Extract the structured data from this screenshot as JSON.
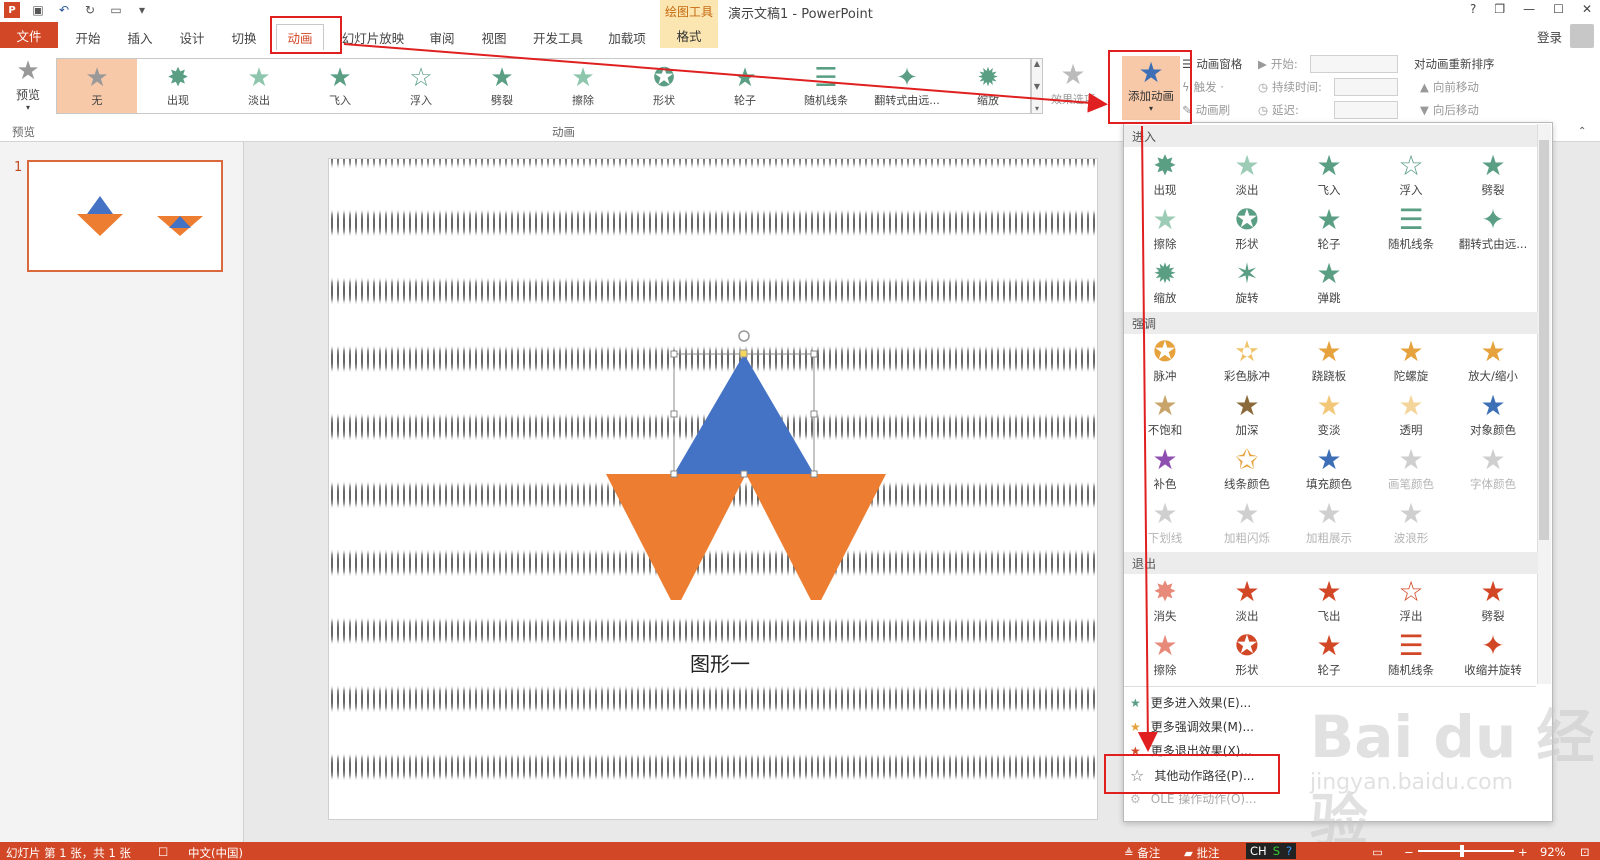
{
  "app": {
    "title": "演示文稿1 - PowerPoint",
    "context_tool": "绘图工具",
    "login": "登录"
  },
  "qat": {
    "icons": [
      "powerpoint-logo",
      "save-icon",
      "undo-icon",
      "redo-icon",
      "present-icon",
      "customize-icon"
    ]
  },
  "window": {
    "help": "?",
    "restore": "❐",
    "minimize": "—",
    "maximize": "☐",
    "close": "✕"
  },
  "tabs": [
    {
      "id": "home",
      "label": "开始"
    },
    {
      "id": "insert",
      "label": "插入"
    },
    {
      "id": "design",
      "label": "设计"
    },
    {
      "id": "transitions",
      "label": "切换"
    },
    {
      "id": "animations",
      "label": "动画"
    },
    {
      "id": "slideshow",
      "label": "幻灯片放映"
    },
    {
      "id": "review",
      "label": "审阅"
    },
    {
      "id": "view",
      "label": "视图"
    },
    {
      "id": "developer",
      "label": "开发工具"
    },
    {
      "id": "addins",
      "label": "加载项"
    }
  ],
  "tab_file": "文件",
  "tab_format": "格式",
  "ribbon": {
    "preview": {
      "label": "预览",
      "group": "预览"
    },
    "gallery_items": [
      "无",
      "出现",
      "淡出",
      "飞入",
      "浮入",
      "劈裂",
      "擦除",
      "形状",
      "轮子",
      "随机线条",
      "翻转式由远...",
      "缩放"
    ],
    "group_animation": "动画",
    "effect_options": "效果选项",
    "add_animation": "添加动画",
    "animation_pane": "动画窗格",
    "trigger": "触发 ·",
    "animation_painter": "动画刷",
    "start": "开始:",
    "duration": "持续时间:",
    "delay": "延迟:",
    "reorder": "对动画重新排序",
    "move_earlier": "向前移动",
    "move_later": "向后移动"
  },
  "slides": {
    "number": "1"
  },
  "slide": {
    "label": "图形一"
  },
  "dropdown": {
    "entrance_header": "进入",
    "entrance": [
      "出现",
      "淡出",
      "飞入",
      "浮入",
      "劈裂",
      "擦除",
      "形状",
      "轮子",
      "随机线条",
      "翻转式由远...",
      "缩放",
      "旋转",
      "弹跳"
    ],
    "emphasis_header": "强调",
    "emphasis": [
      "脉冲",
      "彩色脉冲",
      "跷跷板",
      "陀螺旋",
      "放大/缩小",
      "不饱和",
      "加深",
      "变淡",
      "透明",
      "对象颜色",
      "补色",
      "线条颜色",
      "填充颜色",
      "画笔颜色",
      "字体颜色",
      "下划线",
      "加粗闪烁",
      "加粗展示",
      "波浪形"
    ],
    "exit_header": "退出",
    "exit": [
      "消失",
      "淡出",
      "飞出",
      "浮出",
      "劈裂",
      "擦除",
      "形状",
      "轮子",
      "随机线条",
      "收缩并旋转"
    ],
    "more_entrance": "更多进入效果(E)...",
    "more_emphasis": "更多强调效果(M)...",
    "more_exit": "更多退出效果(X)...",
    "motion_paths": "其他动作路径(P)...",
    "ole": "OLE 操作动作(O)..."
  },
  "status": {
    "slide_info": "幻灯片 第 1 张，共 1 张",
    "language": "中文(中国)",
    "notes": "备注",
    "comments": "批注",
    "ime": "CH",
    "zoom": "92%"
  },
  "watermark": {
    "main": "Bai du 经验",
    "sub": "jingyan.baidu.com"
  },
  "colors": {
    "accent": "#d24726",
    "blue_tri": "#4472c4",
    "orange_tri": "#ed7d31",
    "entrance": "#5a9e84",
    "emphasis": "#e6a23c",
    "exit": "#d24726",
    "highlight": "#e02020"
  }
}
